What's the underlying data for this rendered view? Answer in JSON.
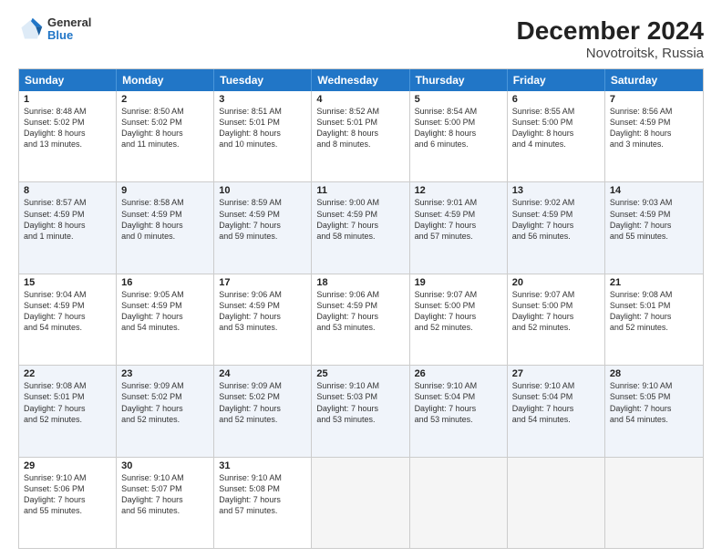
{
  "logo": {
    "general": "General",
    "blue": "Blue"
  },
  "title": "December 2024",
  "subtitle": "Novotroitsk, Russia",
  "days": [
    "Sunday",
    "Monday",
    "Tuesday",
    "Wednesday",
    "Thursday",
    "Friday",
    "Saturday"
  ],
  "weeks": [
    [
      {
        "day": "1",
        "lines": [
          "Sunrise: 8:48 AM",
          "Sunset: 5:02 PM",
          "Daylight: 8 hours",
          "and 13 minutes."
        ]
      },
      {
        "day": "2",
        "lines": [
          "Sunrise: 8:50 AM",
          "Sunset: 5:02 PM",
          "Daylight: 8 hours",
          "and 11 minutes."
        ]
      },
      {
        "day": "3",
        "lines": [
          "Sunrise: 8:51 AM",
          "Sunset: 5:01 PM",
          "Daylight: 8 hours",
          "and 10 minutes."
        ]
      },
      {
        "day": "4",
        "lines": [
          "Sunrise: 8:52 AM",
          "Sunset: 5:01 PM",
          "Daylight: 8 hours",
          "and 8 minutes."
        ]
      },
      {
        "day": "5",
        "lines": [
          "Sunrise: 8:54 AM",
          "Sunset: 5:00 PM",
          "Daylight: 8 hours",
          "and 6 minutes."
        ]
      },
      {
        "day": "6",
        "lines": [
          "Sunrise: 8:55 AM",
          "Sunset: 5:00 PM",
          "Daylight: 8 hours",
          "and 4 minutes."
        ]
      },
      {
        "day": "7",
        "lines": [
          "Sunrise: 8:56 AM",
          "Sunset: 4:59 PM",
          "Daylight: 8 hours",
          "and 3 minutes."
        ]
      }
    ],
    [
      {
        "day": "8",
        "lines": [
          "Sunrise: 8:57 AM",
          "Sunset: 4:59 PM",
          "Daylight: 8 hours",
          "and 1 minute."
        ]
      },
      {
        "day": "9",
        "lines": [
          "Sunrise: 8:58 AM",
          "Sunset: 4:59 PM",
          "Daylight: 8 hours",
          "and 0 minutes."
        ]
      },
      {
        "day": "10",
        "lines": [
          "Sunrise: 8:59 AM",
          "Sunset: 4:59 PM",
          "Daylight: 7 hours",
          "and 59 minutes."
        ]
      },
      {
        "day": "11",
        "lines": [
          "Sunrise: 9:00 AM",
          "Sunset: 4:59 PM",
          "Daylight: 7 hours",
          "and 58 minutes."
        ]
      },
      {
        "day": "12",
        "lines": [
          "Sunrise: 9:01 AM",
          "Sunset: 4:59 PM",
          "Daylight: 7 hours",
          "and 57 minutes."
        ]
      },
      {
        "day": "13",
        "lines": [
          "Sunrise: 9:02 AM",
          "Sunset: 4:59 PM",
          "Daylight: 7 hours",
          "and 56 minutes."
        ]
      },
      {
        "day": "14",
        "lines": [
          "Sunrise: 9:03 AM",
          "Sunset: 4:59 PM",
          "Daylight: 7 hours",
          "and 55 minutes."
        ]
      }
    ],
    [
      {
        "day": "15",
        "lines": [
          "Sunrise: 9:04 AM",
          "Sunset: 4:59 PM",
          "Daylight: 7 hours",
          "and 54 minutes."
        ]
      },
      {
        "day": "16",
        "lines": [
          "Sunrise: 9:05 AM",
          "Sunset: 4:59 PM",
          "Daylight: 7 hours",
          "and 54 minutes."
        ]
      },
      {
        "day": "17",
        "lines": [
          "Sunrise: 9:06 AM",
          "Sunset: 4:59 PM",
          "Daylight: 7 hours",
          "and 53 minutes."
        ]
      },
      {
        "day": "18",
        "lines": [
          "Sunrise: 9:06 AM",
          "Sunset: 4:59 PM",
          "Daylight: 7 hours",
          "and 53 minutes."
        ]
      },
      {
        "day": "19",
        "lines": [
          "Sunrise: 9:07 AM",
          "Sunset: 5:00 PM",
          "Daylight: 7 hours",
          "and 52 minutes."
        ]
      },
      {
        "day": "20",
        "lines": [
          "Sunrise: 9:07 AM",
          "Sunset: 5:00 PM",
          "Daylight: 7 hours",
          "and 52 minutes."
        ]
      },
      {
        "day": "21",
        "lines": [
          "Sunrise: 9:08 AM",
          "Sunset: 5:01 PM",
          "Daylight: 7 hours",
          "and 52 minutes."
        ]
      }
    ],
    [
      {
        "day": "22",
        "lines": [
          "Sunrise: 9:08 AM",
          "Sunset: 5:01 PM",
          "Daylight: 7 hours",
          "and 52 minutes."
        ]
      },
      {
        "day": "23",
        "lines": [
          "Sunrise: 9:09 AM",
          "Sunset: 5:02 PM",
          "Daylight: 7 hours",
          "and 52 minutes."
        ]
      },
      {
        "day": "24",
        "lines": [
          "Sunrise: 9:09 AM",
          "Sunset: 5:02 PM",
          "Daylight: 7 hours",
          "and 52 minutes."
        ]
      },
      {
        "day": "25",
        "lines": [
          "Sunrise: 9:10 AM",
          "Sunset: 5:03 PM",
          "Daylight: 7 hours",
          "and 53 minutes."
        ]
      },
      {
        "day": "26",
        "lines": [
          "Sunrise: 9:10 AM",
          "Sunset: 5:04 PM",
          "Daylight: 7 hours",
          "and 53 minutes."
        ]
      },
      {
        "day": "27",
        "lines": [
          "Sunrise: 9:10 AM",
          "Sunset: 5:04 PM",
          "Daylight: 7 hours",
          "and 54 minutes."
        ]
      },
      {
        "day": "28",
        "lines": [
          "Sunrise: 9:10 AM",
          "Sunset: 5:05 PM",
          "Daylight: 7 hours",
          "and 54 minutes."
        ]
      }
    ],
    [
      {
        "day": "29",
        "lines": [
          "Sunrise: 9:10 AM",
          "Sunset: 5:06 PM",
          "Daylight: 7 hours",
          "and 55 minutes."
        ]
      },
      {
        "day": "30",
        "lines": [
          "Sunrise: 9:10 AM",
          "Sunset: 5:07 PM",
          "Daylight: 7 hours",
          "and 56 minutes."
        ]
      },
      {
        "day": "31",
        "lines": [
          "Sunrise: 9:10 AM",
          "Sunset: 5:08 PM",
          "Daylight: 7 hours",
          "and 57 minutes."
        ]
      },
      {
        "day": "",
        "lines": []
      },
      {
        "day": "",
        "lines": []
      },
      {
        "day": "",
        "lines": []
      },
      {
        "day": "",
        "lines": []
      }
    ]
  ]
}
